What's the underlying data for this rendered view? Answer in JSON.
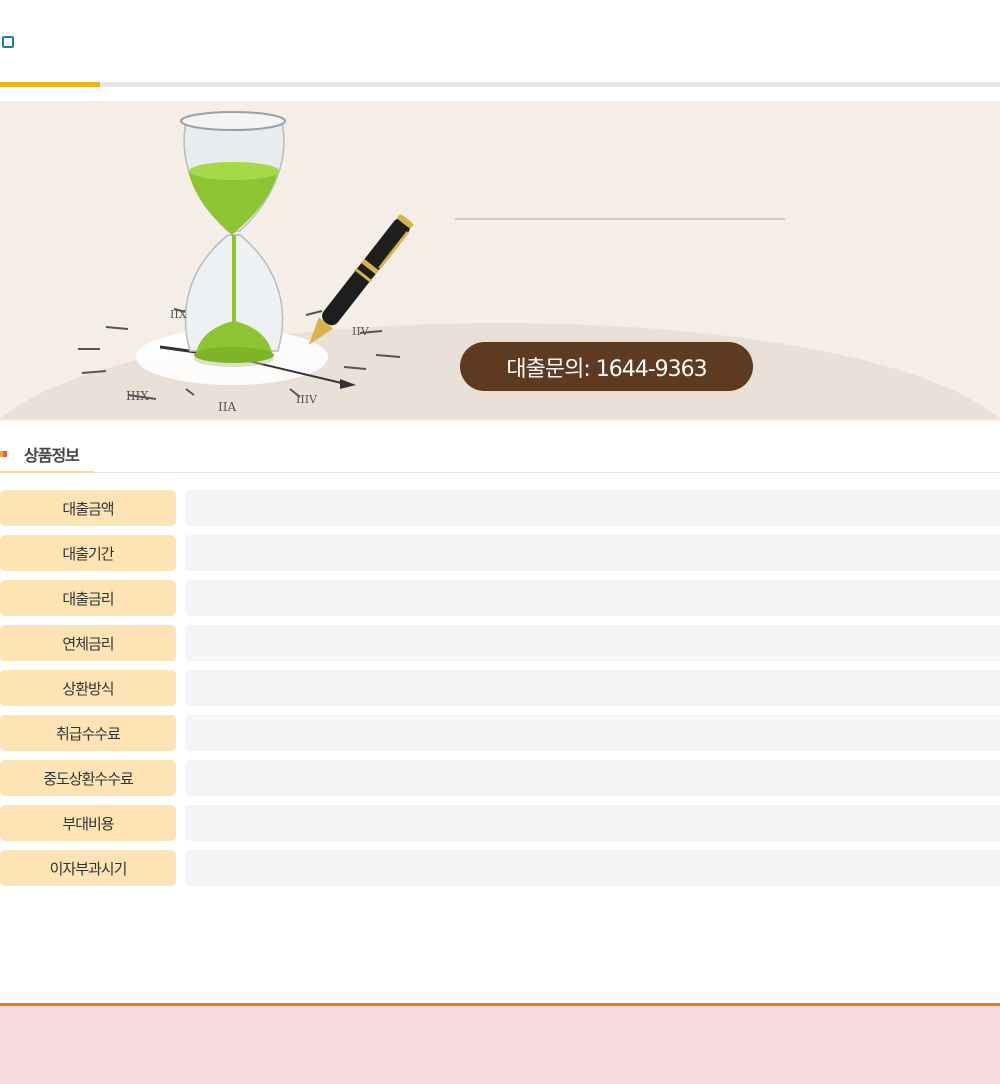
{
  "banner": {
    "contact_label": "대출문의: 1644-9363",
    "clock_numerals": [
      "IIX",
      "IIIX",
      "IIIV",
      "IIV",
      "IIA"
    ]
  },
  "section": {
    "title": "상품정보"
  },
  "info_rows": [
    {
      "label": "대출금액",
      "value": ""
    },
    {
      "label": "대출기간",
      "value": ""
    },
    {
      "label": "대출금리",
      "value": ""
    },
    {
      "label": "연체금리",
      "value": ""
    },
    {
      "label": "상환방식",
      "value": ""
    },
    {
      "label": "취급수수료",
      "value": ""
    },
    {
      "label": "중도상환수수료",
      "value": ""
    },
    {
      "label": "부대비용",
      "value": ""
    },
    {
      "label": "이자부과시기",
      "value": ""
    }
  ],
  "colors": {
    "accent": "#f2b01e",
    "label_bg": "#fee4b4",
    "pill_bg": "#5e3a20",
    "footer_border": "#ea7a1a",
    "footer_bg": "#f7dadd"
  }
}
